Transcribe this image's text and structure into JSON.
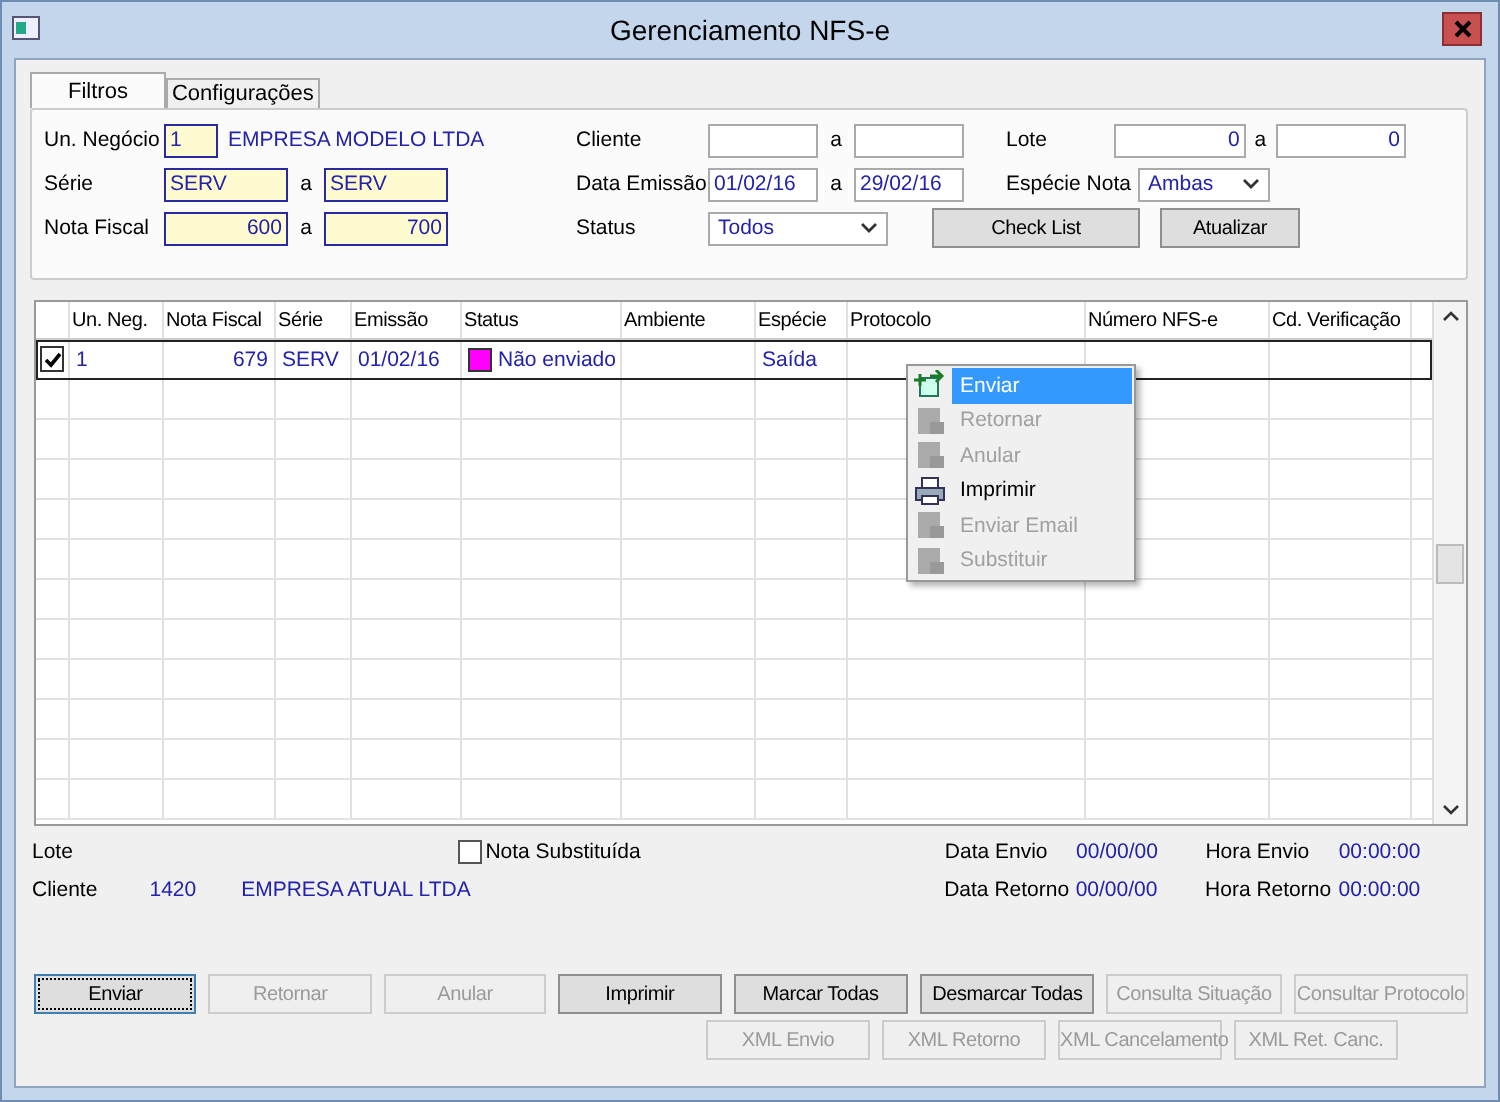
{
  "window": {
    "title": "Gerenciamento NFS-e"
  },
  "tabs": [
    {
      "label": "Filtros",
      "selected": true
    },
    {
      "label": "Configurações",
      "selected": false
    }
  ],
  "filters": {
    "columns": [
      [
        {
          "kind": "single",
          "label": "Un. Negócio",
          "value": "1",
          "note": "EMPRESA MODELO LTDA",
          "highlighted": true
        },
        {
          "kind": "text_range",
          "label": "Série",
          "from": "SERV",
          "separator": "a",
          "to": "SERV",
          "highlighted": true
        },
        {
          "kind": "number_range",
          "label": "Nota Fiscal",
          "from": "600",
          "separator": "a",
          "to": "700",
          "highlighted": true
        }
      ],
      [
        {
          "kind": "text_range",
          "label": "Cliente",
          "separator": "a",
          "highlighted": false
        },
        {
          "kind": "text_range",
          "label": "Data Emissão",
          "from": "01/02/16",
          "separator": "a",
          "to": "29/02/16",
          "highlighted": false
        },
        {
          "kind": "dropdown",
          "label": "Status",
          "value": "Todos"
        }
      ],
      [
        {
          "kind": "number_range",
          "label": "Lote",
          "from": "0",
          "separator": "a",
          "to": "0",
          "highlighted": false
        },
        {
          "kind": "dropdown",
          "label": "Espécie Nota",
          "value": "Ambas"
        },
        {
          "kind": "buttons",
          "buttons": [
            "Check List",
            "Atualizar"
          ]
        }
      ]
    ]
  },
  "table": {
    "columns": [
      "Un. Neg.",
      "Nota Fiscal",
      "Série",
      "Emissão",
      "Status",
      "Ambiente",
      "Espécie",
      "Protocolo",
      "Número NFS-e",
      "Cd. Verificação"
    ],
    "rows": [
      {
        "checked": true,
        "selected": true,
        "color": "#ff00ff",
        "cells": [
          "1",
          "679",
          "SERV",
          "01/02/16",
          "Não enviado",
          "",
          "Saída",
          "",
          "",
          ""
        ]
      }
    ]
  },
  "context_menu": [
    {
      "label": "Enviar",
      "selected": true,
      "disabled": false
    },
    {
      "label": "Retornar",
      "selected": false,
      "disabled": true
    },
    {
      "label": "Anular",
      "selected": false,
      "disabled": true
    },
    {
      "label": "Imprimir",
      "selected": false,
      "disabled": false
    },
    {
      "label": "Enviar Email",
      "selected": false,
      "disabled": true
    },
    {
      "label": "Substituir",
      "selected": false,
      "disabled": true
    }
  ],
  "info": {
    "lote_label": "Lote",
    "nota_substituida": {
      "label": "Nota Substituída",
      "checked": false
    },
    "cliente": {
      "label": "Cliente",
      "code": "1420",
      "name": "EMPRESA ATUAL LTDA"
    },
    "dates": [
      {
        "label": "Data Envio",
        "value": "00/00/00"
      },
      {
        "label": "Hora Envio",
        "value": "00:00:00"
      },
      {
        "label": "Data Retorno",
        "value": "00/00/00"
      },
      {
        "label": "Hora Retorno",
        "value": "00:00:00"
      }
    ]
  },
  "buttons": [
    [
      {
        "label": "Enviar",
        "disabled": false,
        "focused": true
      },
      {
        "label": "Retornar",
        "disabled": true,
        "focused": false
      },
      {
        "label": "Anular",
        "disabled": true,
        "focused": false
      },
      {
        "label": "Imprimir",
        "disabled": false,
        "focused": false
      },
      {
        "label": "Marcar Todas",
        "disabled": false,
        "focused": false
      },
      {
        "label": "Desmarcar Todas",
        "disabled": false,
        "focused": false
      },
      {
        "label": "Consulta Situação",
        "disabled": true,
        "focused": false
      },
      {
        "label": "Consultar Protocolo",
        "disabled": true,
        "focused": false
      }
    ],
    [
      {
        "label": "XML Envio",
        "disabled": true,
        "focused": false
      },
      {
        "label": "XML Retorno",
        "disabled": true,
        "focused": false
      },
      {
        "label": "XML Cancelamento",
        "disabled": true,
        "focused": false
      },
      {
        "label": "XML Ret. Canc.",
        "disabled": true,
        "focused": false
      }
    ]
  ]
}
